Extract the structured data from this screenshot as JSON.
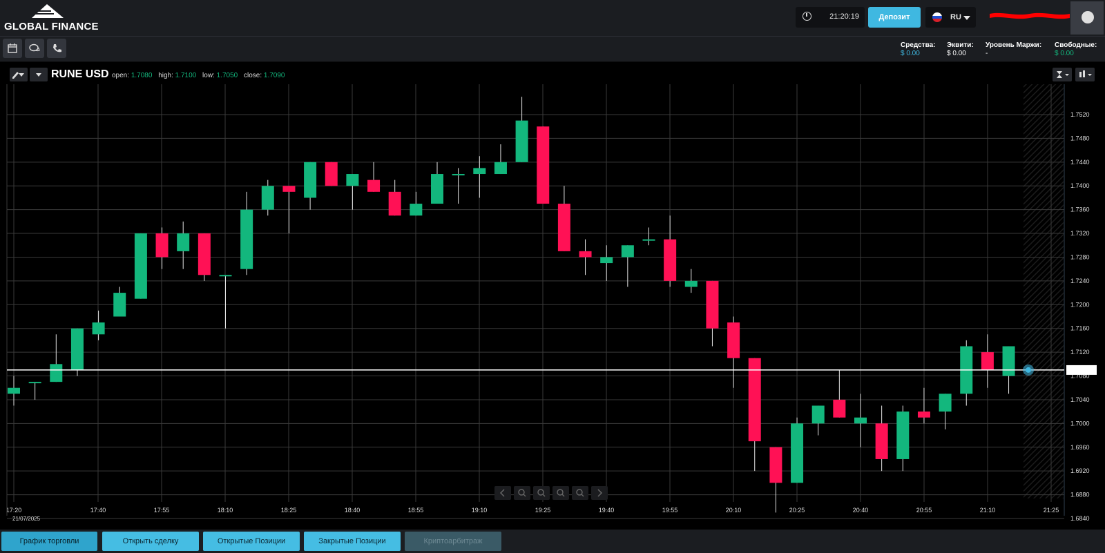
{
  "brand": {
    "name": "GLOBAL FINANCE"
  },
  "header": {
    "time": "21:20:19",
    "deposit_label": "Депозит",
    "language": "RU"
  },
  "toolbar": {
    "icons": [
      "calendar-icon",
      "chat-icon",
      "phone-icon"
    ]
  },
  "account": {
    "funds_label": "Средства:",
    "funds_value": "$ 0.00",
    "equity_label": "Эквити:",
    "equity_value": "$ 0.00",
    "margin_level_label": "Уровень Маржи:",
    "margin_level_value": "-",
    "free_label": "Свободные:",
    "free_value": "$ 0.00"
  },
  "instrument": {
    "symbol": "RUNE USD",
    "open_label": "open:",
    "open": "1.7080",
    "high_label": "high:",
    "high": "1.7100",
    "low_label": "low:",
    "low": "1.7050",
    "close_label": "close:",
    "close": "1.7090"
  },
  "chart_data": {
    "type": "candlestick",
    "date_label": "21/07/2025",
    "x_ticks": [
      "17:20",
      "17:40",
      "17:55",
      "18:10",
      "18:25",
      "18:40",
      "18:55",
      "19:10",
      "19:25",
      "19:40",
      "19:55",
      "20:10",
      "20:25",
      "20:40",
      "20:55",
      "21:10",
      "21:25"
    ],
    "y_ticks": [
      "1.7520",
      "1.7480",
      "1.7440",
      "1.7400",
      "1.7360",
      "1.7320",
      "1.7280",
      "1.7240",
      "1.7200",
      "1.7160",
      "1.7120",
      "1.7080",
      "1.7040",
      "1.7000",
      "1.6960",
      "1.6920",
      "1.6880",
      "1.6840"
    ],
    "ylim": [
      1.684,
      1.752
    ],
    "current_price": 1.709,
    "colors": {
      "up": "#13b77d",
      "down": "#ff1155",
      "grid": "#3a3a3a",
      "price_line": "#ffffff"
    },
    "candles": [
      [
        1.705,
        1.708,
        1.703,
        1.706
      ],
      [
        1.707,
        1.707,
        1.704,
        1.707
      ],
      [
        1.707,
        1.715,
        1.707,
        1.71
      ],
      [
        1.709,
        1.716,
        1.708,
        1.716
      ],
      [
        1.715,
        1.719,
        1.714,
        1.717
      ],
      [
        1.718,
        1.723,
        1.718,
        1.722
      ],
      [
        1.721,
        1.732,
        1.721,
        1.732
      ],
      [
        1.732,
        1.733,
        1.726,
        1.728
      ],
      [
        1.729,
        1.734,
        1.726,
        1.732
      ],
      [
        1.732,
        1.732,
        1.724,
        1.725
      ],
      [
        1.725,
        1.725,
        1.716,
        1.725
      ],
      [
        1.726,
        1.739,
        1.725,
        1.736
      ],
      [
        1.736,
        1.741,
        1.735,
        1.74
      ],
      [
        1.74,
        1.74,
        1.732,
        1.739
      ],
      [
        1.738,
        1.744,
        1.736,
        1.744
      ],
      [
        1.744,
        1.744,
        1.74,
        1.74
      ],
      [
        1.74,
        1.742,
        1.736,
        1.742
      ],
      [
        1.741,
        1.744,
        1.739,
        1.739
      ],
      [
        1.739,
        1.741,
        1.735,
        1.735
      ],
      [
        1.735,
        1.739,
        1.735,
        1.737
      ],
      [
        1.737,
        1.744,
        1.737,
        1.742
      ],
      [
        1.742,
        1.743,
        1.737,
        1.742
      ],
      [
        1.742,
        1.745,
        1.738,
        1.743
      ],
      [
        1.742,
        1.747,
        1.742,
        1.744
      ],
      [
        1.744,
        1.755,
        1.744,
        1.751
      ],
      [
        1.75,
        1.75,
        1.737,
        1.737
      ],
      [
        1.737,
        1.74,
        1.729,
        1.729
      ],
      [
        1.729,
        1.731,
        1.725,
        1.728
      ],
      [
        1.727,
        1.73,
        1.724,
        1.728
      ],
      [
        1.728,
        1.73,
        1.723,
        1.73
      ],
      [
        1.731,
        1.733,
        1.73,
        1.731
      ],
      [
        1.731,
        1.735,
        1.723,
        1.724
      ],
      [
        1.723,
        1.726,
        1.722,
        1.724
      ],
      [
        1.724,
        1.724,
        1.713,
        1.716
      ],
      [
        1.717,
        1.718,
        1.706,
        1.711
      ],
      [
        1.711,
        1.711,
        1.692,
        1.697
      ],
      [
        1.696,
        1.696,
        1.685,
        1.69
      ],
      [
        1.69,
        1.701,
        1.69,
        1.7
      ],
      [
        1.7,
        1.703,
        1.698,
        1.703
      ],
      [
        1.704,
        1.709,
        1.701,
        1.701
      ],
      [
        1.7,
        1.705,
        1.696,
        1.701
      ],
      [
        1.7,
        1.703,
        1.692,
        1.694
      ],
      [
        1.694,
        1.703,
        1.692,
        1.702
      ],
      [
        1.702,
        1.706,
        1.7,
        1.701
      ],
      [
        1.702,
        1.705,
        1.699,
        1.705
      ],
      [
        1.705,
        1.714,
        1.703,
        1.713
      ],
      [
        1.712,
        1.715,
        1.706,
        1.709
      ],
      [
        1.708,
        1.713,
        1.705,
        1.713
      ]
    ]
  },
  "nav_controls": [
    "chevron-left-icon",
    "zoom-in-icon",
    "zoom-in-icon",
    "zoom-out-icon",
    "zoom-out-icon",
    "chevron-right-icon"
  ],
  "bottom_tabs": [
    {
      "label": "График торговли"
    },
    {
      "label": "Открыть сделку"
    },
    {
      "label": "Открытые Позиции"
    },
    {
      "label": "Закрытые Позиции"
    },
    {
      "label": "Криптоарбитраж"
    }
  ]
}
